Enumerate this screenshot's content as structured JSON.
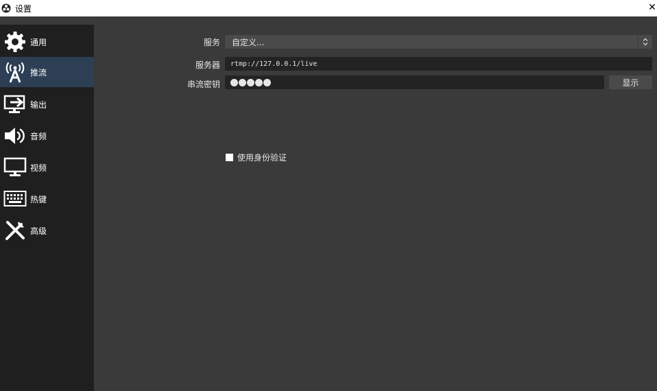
{
  "window": {
    "title": "设置",
    "close_glyph": "✕"
  },
  "sidebar": {
    "items": [
      {
        "label": "通用",
        "icon": "gear-icon"
      },
      {
        "label": "推流",
        "icon": "antenna-icon"
      },
      {
        "label": "输出",
        "icon": "output-monitor-icon"
      },
      {
        "label": "音频",
        "icon": "speaker-icon"
      },
      {
        "label": "视频",
        "icon": "monitor-icon"
      },
      {
        "label": "热键",
        "icon": "keyboard-icon"
      },
      {
        "label": "高级",
        "icon": "tools-icon"
      }
    ],
    "active_index": 1
  },
  "stream": {
    "service_label": "服务",
    "service_value": "自定义...",
    "server_label": "服务器",
    "server_value": "rtmp://127.0.0.1/live",
    "key_label": "串流密钥",
    "key_dots": 5,
    "show_button": "显示",
    "auth_checkbox_label": "使用身份验证",
    "auth_checked": false
  },
  "colors": {
    "sidebar_active": "#2d3f54",
    "panel_bg": "#3a3a3a",
    "sidebar_bg": "#1f1f1f"
  }
}
